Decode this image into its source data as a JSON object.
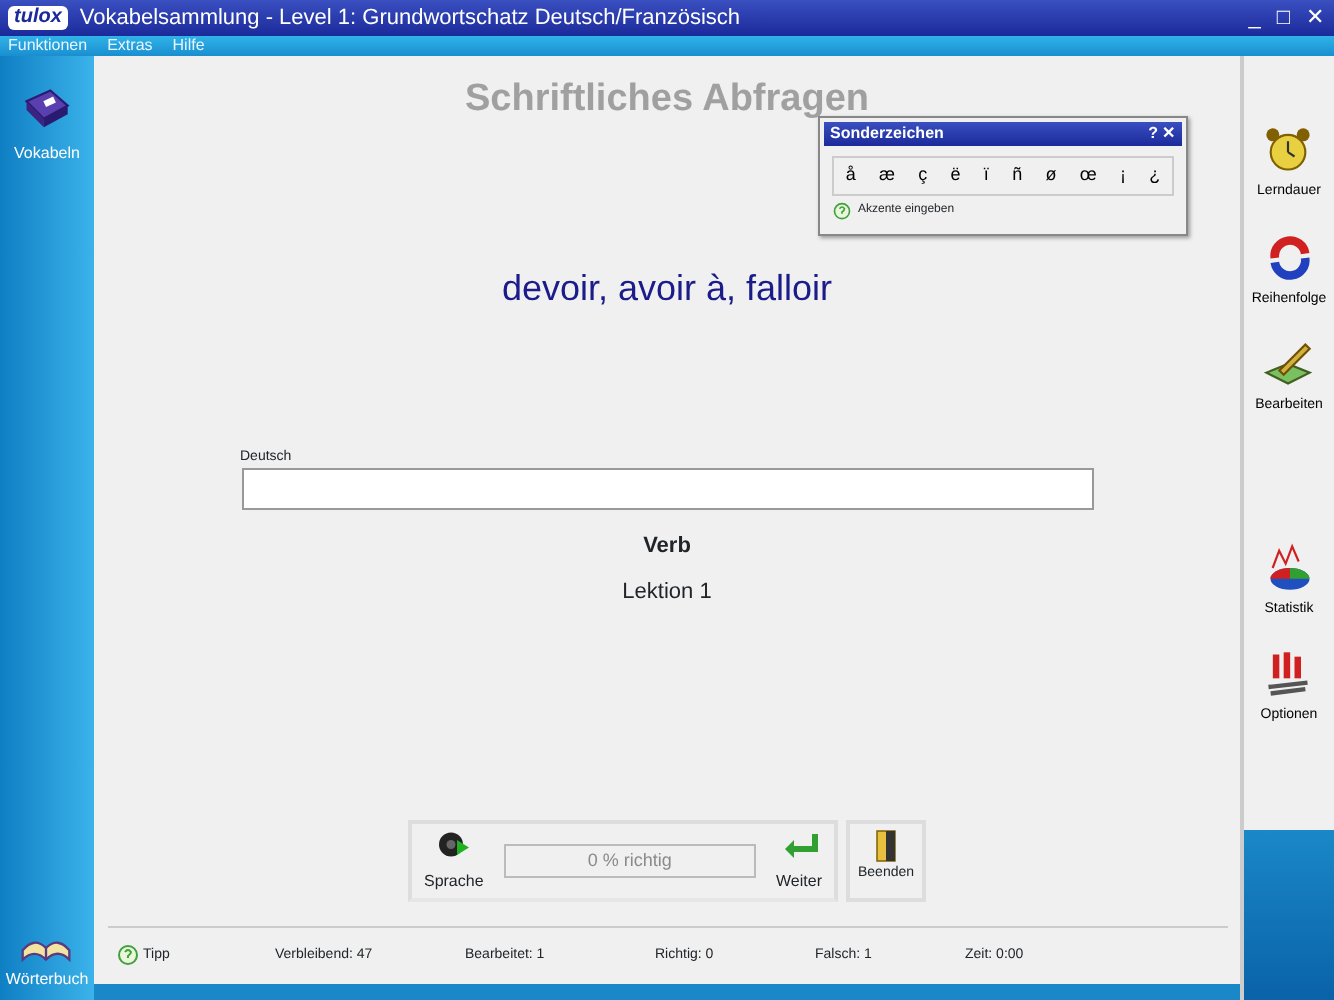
{
  "window": {
    "title": "Vokabelsammlung - Level 1: Grundwortschatz Deutsch/Französisch",
    "logo": "tulox",
    "controls": [
      "_",
      "□",
      "✕"
    ]
  },
  "menu": [
    "Funktionen",
    "Extras",
    "Hilfe"
  ],
  "left_sidebar": {
    "items": [
      {
        "label": "Vokabeln",
        "kind": "book"
      },
      {
        "label": "Wörterbuch",
        "kind": "dictionary"
      }
    ]
  },
  "heading": "Schriftliches Abfragen",
  "question": "devoir, avoir à, falloir",
  "answer_field": {
    "label": "Deutsch"
  },
  "word_type": "Verb",
  "lesson": "Lektion 1",
  "toolbar": {
    "speech": "Sprache",
    "progress": {
      "level": 0,
      "text": "0 % richtig"
    },
    "next": "Weiter",
    "quit": "Beenden"
  },
  "status_bar": {
    "tip": "Tipp",
    "items": [
      "Verbleibend: 47",
      "Bearbeitet: 1",
      "Richtig: 0",
      "Falsch: 1",
      "Zeit: 0:00"
    ]
  },
  "right_sidebar": {
    "items": [
      {
        "label": "Lerndauer",
        "kind": "clock"
      },
      {
        "label": "Reihenfolge",
        "kind": "cycle"
      },
      {
        "label": "Bearbeiten",
        "kind": "edit"
      },
      {
        "label": "Statistik",
        "kind": "chart"
      },
      {
        "label": "Optionen",
        "kind": "options"
      }
    ]
  },
  "special_chars": {
    "title": "Sonderzeichen",
    "buttons": [
      "?",
      "✕"
    ],
    "chars": [
      "å",
      "æ",
      "ç",
      "ë",
      "ï",
      "ñ",
      "ø",
      "œ",
      "¡",
      "¿"
    ],
    "hint": "Akzente eingeben"
  }
}
